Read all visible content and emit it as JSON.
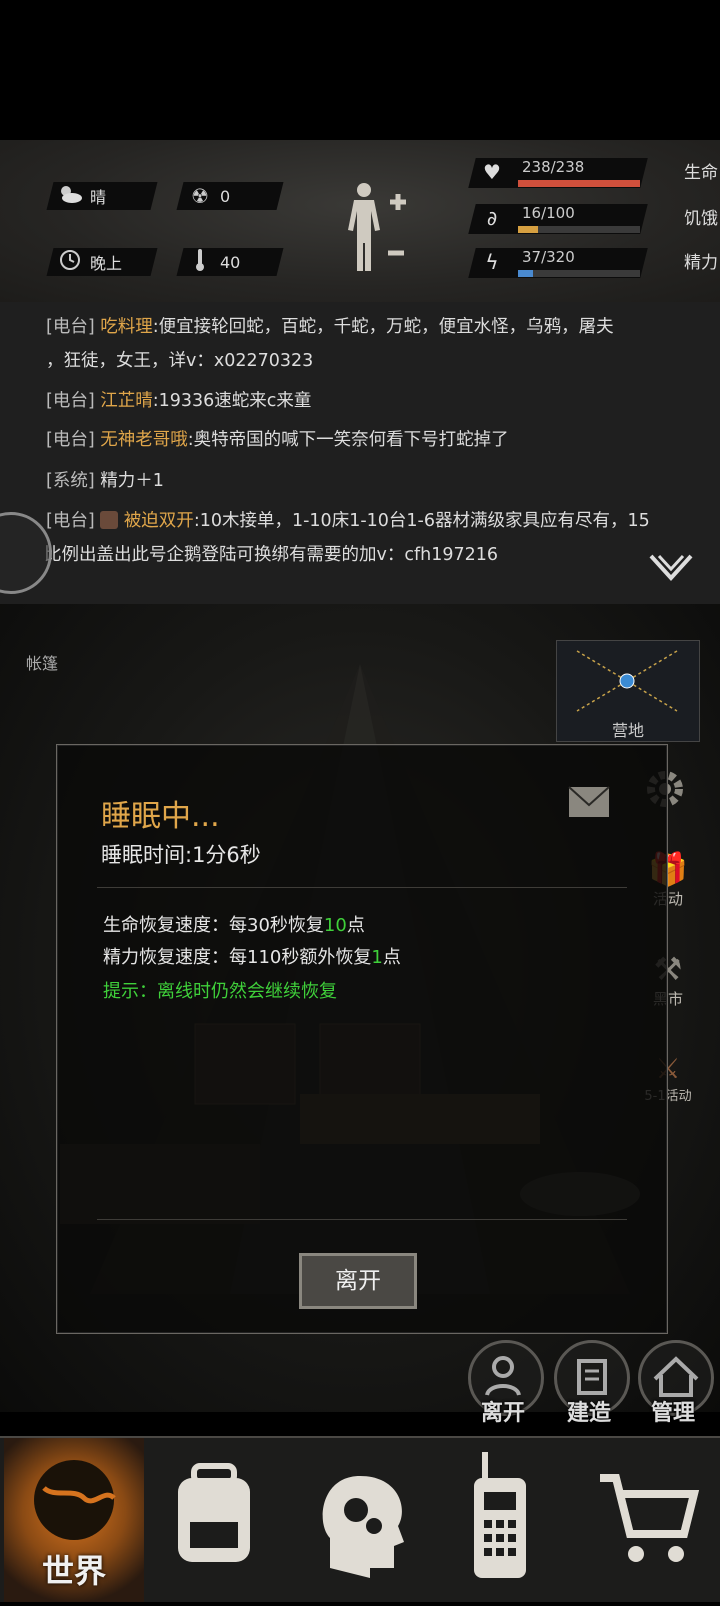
{
  "status": {
    "weather": "晴",
    "radiation": "0",
    "time_of_day": "晚上",
    "temperature": "40",
    "bars": [
      {
        "label": "生命",
        "value_text": "238/238",
        "fraction": 1.0,
        "color": "#d0503c",
        "icon": "heart-icon"
      },
      {
        "label": "饥饿",
        "value_text": "16/100",
        "fraction": 0.16,
        "color": "#d6a041",
        "icon": "stomach-icon"
      },
      {
        "label": "精力",
        "value_text": "37/320",
        "fraction": 0.12,
        "color": "#4a8ad0",
        "icon": "energy-icon"
      }
    ]
  },
  "chat": {
    "messages": [
      {
        "tag": "[电台]",
        "author": "吃料理",
        "text": ":便宜接轮回蛇，百蛇，千蛇，万蛇，便宜水怪，乌鸦，屠夫",
        "cont": "，狂徒，女王，详v：x02270323"
      },
      {
        "tag": "[电台]",
        "author": "江芷晴",
        "text": ":19336速蛇来c来童"
      },
      {
        "tag": "[电台]",
        "author": "无神老哥哦",
        "text": ":奥特帝国的喊下一笑奈何看下号打蛇掉了"
      },
      {
        "tag": "[系统]",
        "author": "",
        "text": "精力＋1"
      },
      {
        "tag": "[电台]",
        "author": "被迫双开",
        "text": ":10木接单，1-10床1-10台1-6器材满级家具应有尽有，15",
        "cont": "比例出盖出此号企鹅登陆可换绑有需要的加v：cfh197216"
      }
    ]
  },
  "scene": {
    "location_label": "帐篷",
    "map_label": "营地",
    "side_buttons": {
      "activity": "活动",
      "black_market": "黑市",
      "event": "5-1活动"
    }
  },
  "dialog": {
    "title": "睡眠中...",
    "sleep_time": "睡眠时间:1分6秒",
    "hp_rate_prefix": "生命恢复速度：每30秒恢复",
    "hp_rate_value": "10",
    "hp_rate_suffix": "点",
    "energy_rate_prefix": "精力恢复速度：每110秒额外恢复",
    "energy_rate_value": "1",
    "energy_rate_suffix": "点",
    "hint": "提示：离线时仍然会继续恢复",
    "leave_button": "离开"
  },
  "actions": {
    "leave": "离开",
    "build": "建造",
    "manage": "管理"
  },
  "nav": {
    "world": "世界"
  },
  "colors": {
    "accent": "#e0a64a",
    "green": "#3fd03a",
    "hint_green": "#3fd03a"
  }
}
